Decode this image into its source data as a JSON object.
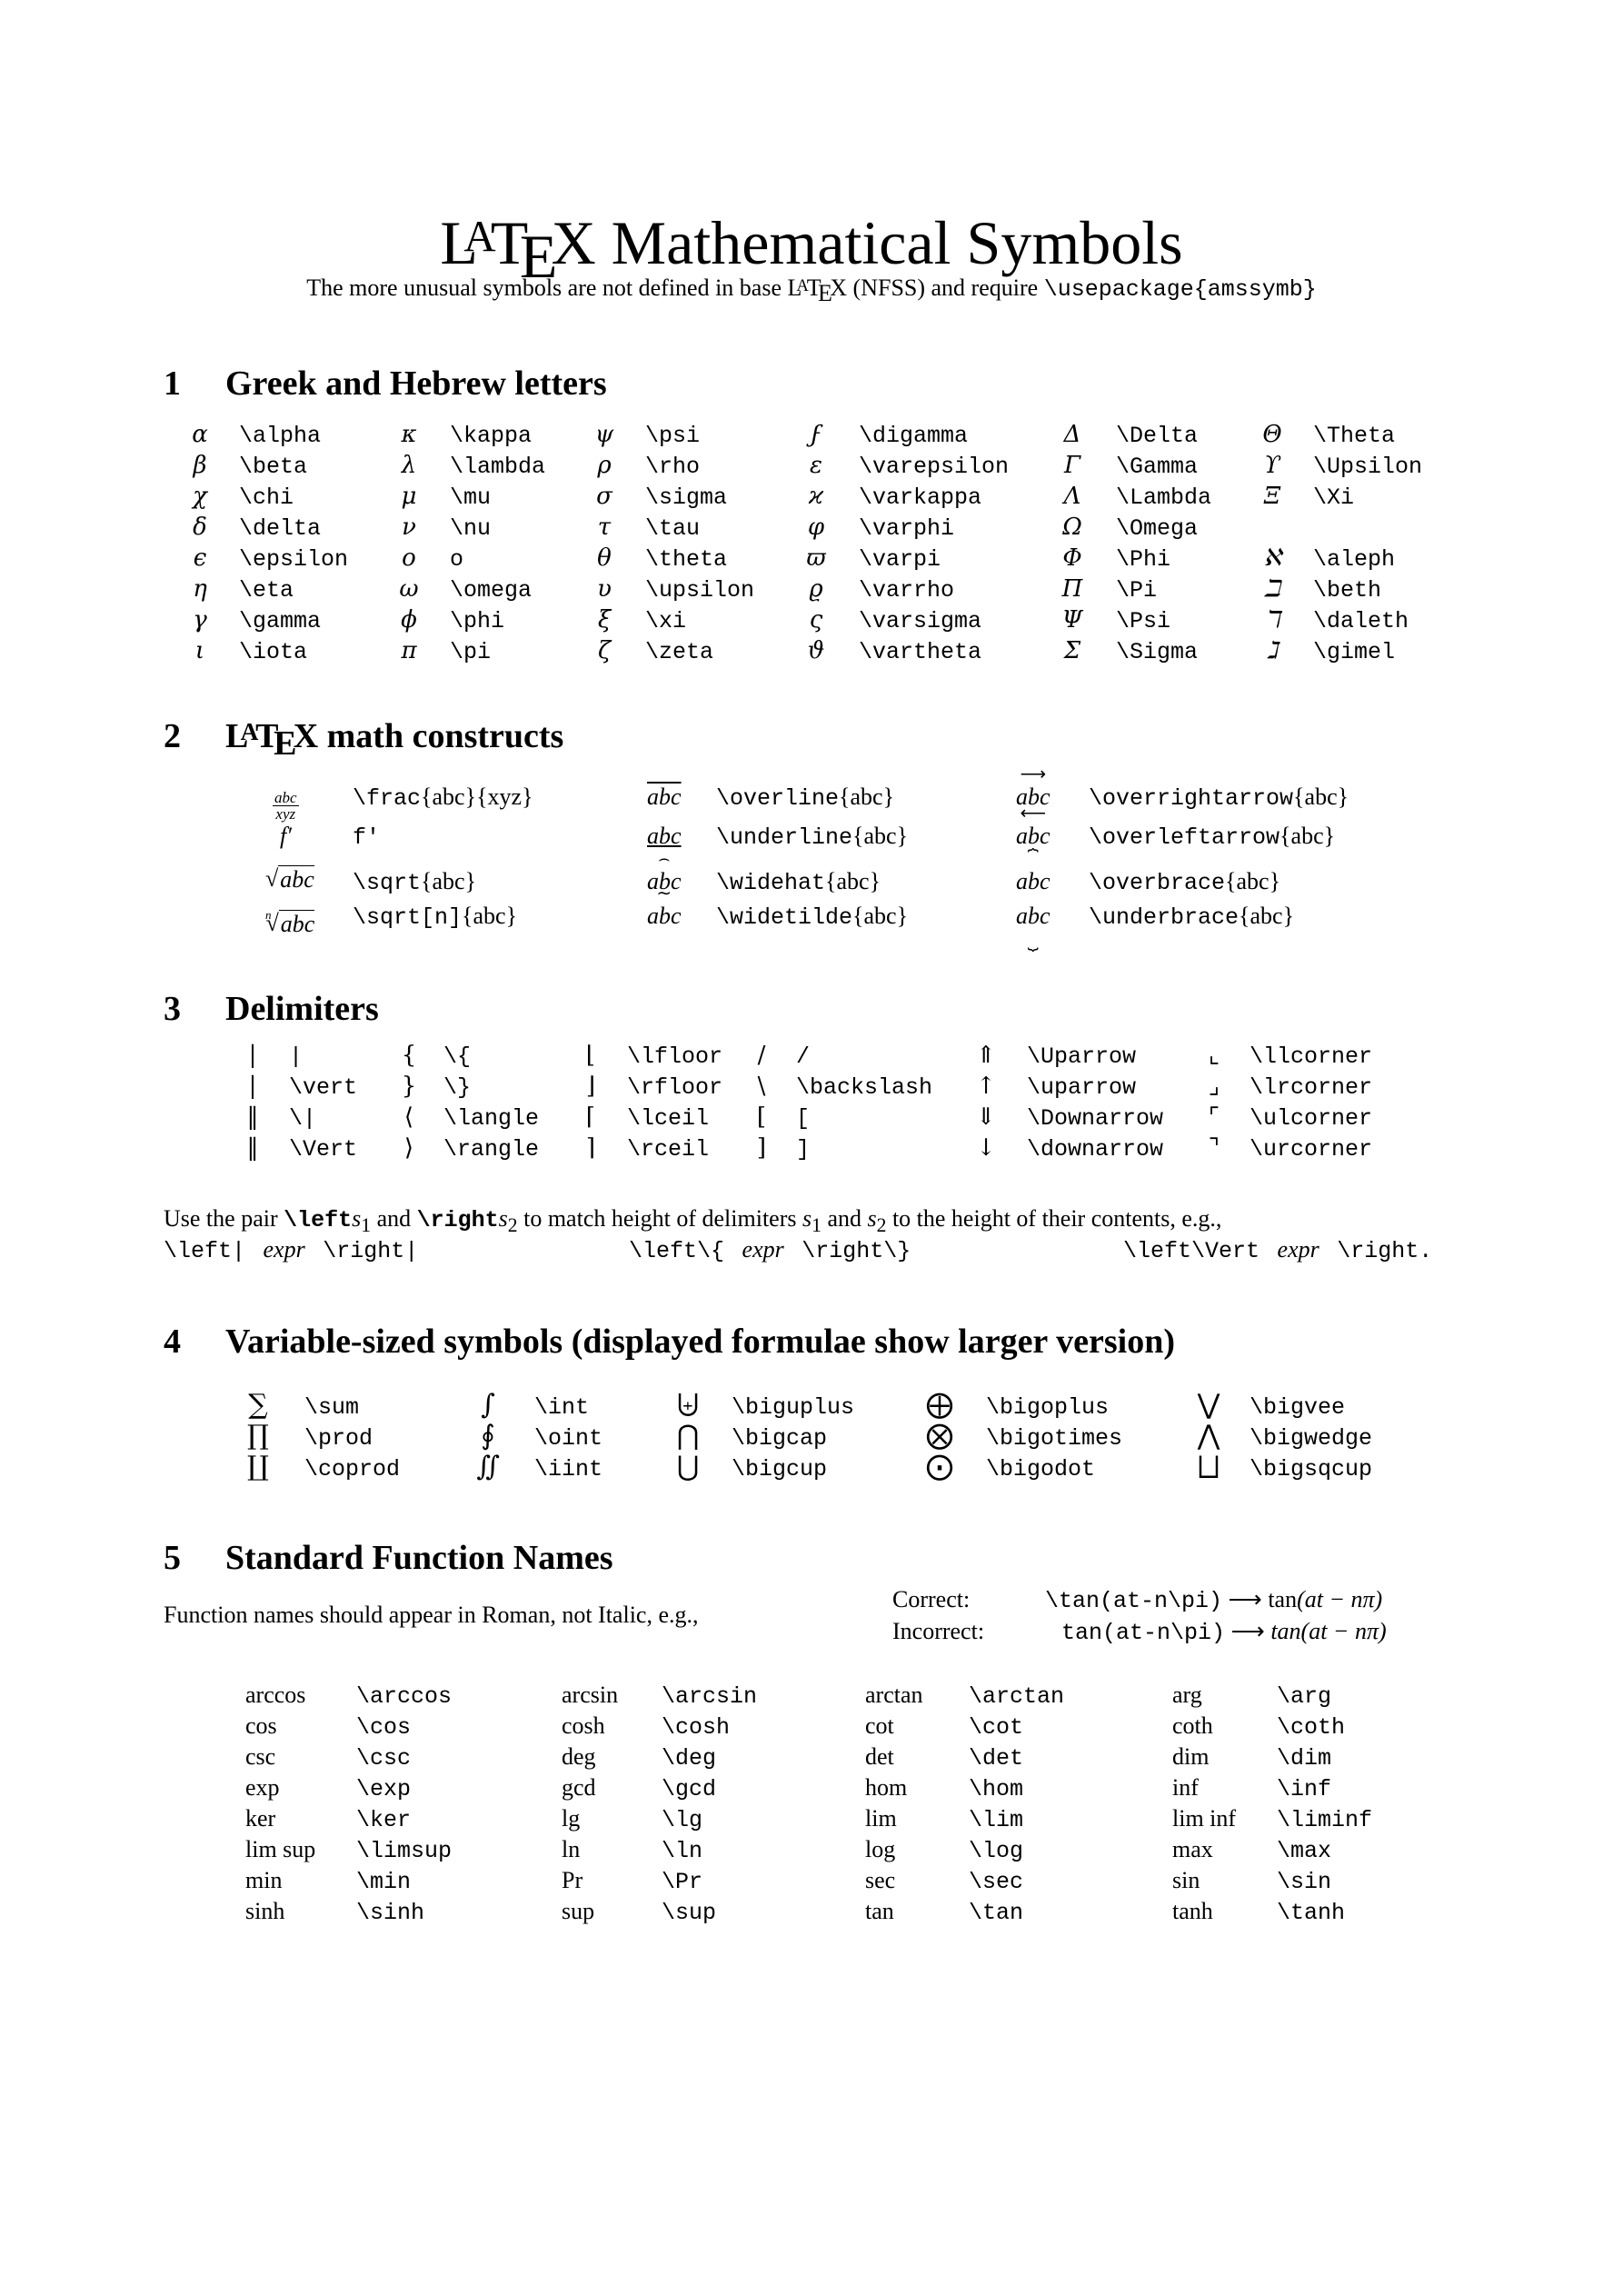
{
  "header": {
    "title_prefix_latex": {
      "L": "L",
      "A": "A",
      "T": "T",
      "E": "E",
      "X": "X"
    },
    "title_rest": "Mathematical Symbols",
    "subtitle_before": "The more unusual symbols are not defined in base",
    "subtitle_mid": "(NFSS) and require",
    "subtitle_cmd": "\\usepackage{amssymb}"
  },
  "sections": {
    "s1": {
      "num": "1",
      "title": "Greek and Hebrew letters"
    },
    "s2": {
      "num": "2",
      "title_rest": "math constructs"
    },
    "s3": {
      "num": "3",
      "title": "Delimiters"
    },
    "s4": {
      "num": "4",
      "title": "Variable-sized symbols (displayed formulae show larger version)"
    },
    "s5": {
      "num": "5",
      "title": "Standard Function Names"
    }
  },
  "greek": {
    "columns": [
      [
        {
          "sym": "α",
          "cmd": "\\alpha"
        },
        {
          "sym": "β",
          "cmd": "\\beta"
        },
        {
          "sym": "χ",
          "cmd": "\\chi"
        },
        {
          "sym": "δ",
          "cmd": "\\delta"
        },
        {
          "sym": "ϵ",
          "cmd": "\\epsilon"
        },
        {
          "sym": "η",
          "cmd": "\\eta"
        },
        {
          "sym": "γ",
          "cmd": "\\gamma"
        },
        {
          "sym": "ι",
          "cmd": "\\iota"
        }
      ],
      [
        {
          "sym": "κ",
          "cmd": "\\kappa"
        },
        {
          "sym": "λ",
          "cmd": "\\lambda"
        },
        {
          "sym": "μ",
          "cmd": "\\mu"
        },
        {
          "sym": "ν",
          "cmd": "\\nu"
        },
        {
          "sym": "o",
          "cmd": "o"
        },
        {
          "sym": "ω",
          "cmd": "\\omega"
        },
        {
          "sym": "ϕ",
          "cmd": "\\phi"
        },
        {
          "sym": "π",
          "cmd": "\\pi"
        }
      ],
      [
        {
          "sym": "ψ",
          "cmd": "\\psi"
        },
        {
          "sym": "ρ",
          "cmd": "\\rho"
        },
        {
          "sym": "σ",
          "cmd": "\\sigma"
        },
        {
          "sym": "τ",
          "cmd": "\\tau"
        },
        {
          "sym": "θ",
          "cmd": "\\theta"
        },
        {
          "sym": "υ",
          "cmd": "\\upsilon"
        },
        {
          "sym": "ξ",
          "cmd": "\\xi"
        },
        {
          "sym": "ζ",
          "cmd": "\\zeta"
        }
      ],
      [
        {
          "sym": "ϝ",
          "cmd": "\\digamma"
        },
        {
          "sym": "ε",
          "cmd": "\\varepsilon"
        },
        {
          "sym": "ϰ",
          "cmd": "\\varkappa"
        },
        {
          "sym": "φ",
          "cmd": "\\varphi"
        },
        {
          "sym": "ϖ",
          "cmd": "\\varpi"
        },
        {
          "sym": "ϱ",
          "cmd": "\\varrho"
        },
        {
          "sym": "ς",
          "cmd": "\\varsigma"
        },
        {
          "sym": "ϑ",
          "cmd": "\\vartheta"
        }
      ],
      [
        {
          "sym": "Δ",
          "cmd": "\\Delta"
        },
        {
          "sym": "Γ",
          "cmd": "\\Gamma"
        },
        {
          "sym": "Λ",
          "cmd": "\\Lambda"
        },
        {
          "sym": "Ω",
          "cmd": "\\Omega"
        },
        {
          "sym": "Φ",
          "cmd": "\\Phi"
        },
        {
          "sym": "Π",
          "cmd": "\\Pi"
        },
        {
          "sym": "Ψ",
          "cmd": "\\Psi"
        },
        {
          "sym": "Σ",
          "cmd": "\\Sigma"
        }
      ],
      [
        {
          "sym": "Θ",
          "cmd": "\\Theta"
        },
        {
          "sym": "ϒ",
          "cmd": "\\Upsilon"
        },
        {
          "sym": "Ξ",
          "cmd": "\\Xi"
        },
        {
          "sym": "",
          "cmd": ""
        },
        {
          "sym": "ℵ",
          "cmd": "\\aleph"
        },
        {
          "sym": "ℶ",
          "cmd": "\\beth"
        },
        {
          "sym": "ℸ",
          "cmd": "\\daleth"
        },
        {
          "sym": "ℷ",
          "cmd": "\\gimel"
        }
      ]
    ]
  },
  "constructs": {
    "frac": {
      "num": "abc",
      "den": "xyz",
      "cmd": "\\frac",
      "arg1": "{abc}",
      "arg2": "{xyz}"
    },
    "prime": {
      "sym": "f′",
      "cmd": "f'"
    },
    "sqrt": {
      "sym": "abc",
      "cmd": "\\sqrt",
      "arg": "{abc}"
    },
    "sqrtn": {
      "idx": "n",
      "sym": "abc",
      "cmd": "\\sqrt[n]",
      "arg": "{abc}"
    },
    "overline": {
      "sym": "abc",
      "cmd": "\\overline",
      "arg": "{abc}"
    },
    "underline": {
      "sym": "abc",
      "cmd": "\\underline",
      "arg": "{abc}"
    },
    "widehat": {
      "sym": "abc",
      "mark": "⌢",
      "cmd": "\\widehat",
      "arg": "{abc}"
    },
    "widetilde": {
      "sym": "abc",
      "mark": "∼",
      "cmd": "\\widetilde",
      "arg": "{abc}"
    },
    "overrightarrow": {
      "sym": "abc",
      "mark": "⟶",
      "cmd": "\\overrightarrow",
      "arg": "{abc}"
    },
    "overleftarrow": {
      "sym": "abc",
      "mark": "⟵",
      "cmd": "\\overleftarrow",
      "arg": "{abc}"
    },
    "overbrace": {
      "sym": "abc",
      "mark": "⏞",
      "cmd": "\\overbrace",
      "arg": "{abc}"
    },
    "underbrace": {
      "sym": "abc",
      "mark": "⏟",
      "cmd": "\\underbrace",
      "arg": "{abc}"
    }
  },
  "delimiters": {
    "columns": [
      [
        {
          "sym": "|",
          "cmd": "|"
        },
        {
          "sym": "|",
          "cmd": "\\vert"
        },
        {
          "sym": "‖",
          "cmd": "\\|"
        },
        {
          "sym": "‖",
          "cmd": "\\Vert"
        }
      ],
      [
        {
          "sym": "{",
          "cmd": "\\{"
        },
        {
          "sym": "}",
          "cmd": "\\}"
        },
        {
          "sym": "⟨",
          "cmd": "\\langle"
        },
        {
          "sym": "⟩",
          "cmd": "\\rangle"
        }
      ],
      [
        {
          "sym": "⌊",
          "cmd": "\\lfloor"
        },
        {
          "sym": "⌋",
          "cmd": "\\rfloor"
        },
        {
          "sym": "⌈",
          "cmd": "\\lceil"
        },
        {
          "sym": "⌉",
          "cmd": "\\rceil"
        }
      ],
      [
        {
          "sym": "/",
          "cmd": "/"
        },
        {
          "sym": "\\",
          "cmd": "\\backslash"
        },
        {
          "sym": "[",
          "cmd": "["
        },
        {
          "sym": "]",
          "cmd": "]"
        }
      ],
      [
        {
          "sym": "⇑",
          "cmd": "\\Uparrow"
        },
        {
          "sym": "↑",
          "cmd": "\\uparrow"
        },
        {
          "sym": "⇓",
          "cmd": "\\Downarrow"
        },
        {
          "sym": "↓",
          "cmd": "\\downarrow"
        }
      ],
      [
        {
          "sym": "⌞",
          "cmd": "\\llcorner"
        },
        {
          "sym": "⌟",
          "cmd": "\\lrcorner"
        },
        {
          "sym": "⌜",
          "cmd": "\\ulcorner"
        },
        {
          "sym": "⌝",
          "cmd": "\\urcorner"
        }
      ]
    ],
    "note": {
      "t1": "Use the pair",
      "c1": "\\left",
      "s1": "s",
      "sub1": "1",
      "t2": "and",
      "c2": "\\right",
      "s2": "s",
      "sub2": "2",
      "t3": "to match height of delimiters",
      "t4": "and",
      "t5": "to the height of their contents, e.g.,"
    },
    "examples": [
      {
        "left": "\\left|",
        "expr": "expr",
        "right": "\\right|"
      },
      {
        "left": "\\left\\{",
        "expr": "expr",
        "right": "\\right\\}"
      },
      {
        "left": "\\left\\Vert",
        "expr": "expr",
        "right": "\\right."
      }
    ]
  },
  "variable_sized": {
    "columns": [
      [
        {
          "sym": "∑",
          "cmd": "\\sum"
        },
        {
          "sym": "∏",
          "cmd": "\\prod"
        },
        {
          "sym": "∐",
          "cmd": "\\coprod"
        }
      ],
      [
        {
          "sym": "∫",
          "cmd": "\\int"
        },
        {
          "sym": "∮",
          "cmd": "\\oint"
        },
        {
          "sym": "∬",
          "cmd": "\\iint"
        }
      ],
      [
        {
          "sym": "⨄",
          "cmd": "\\biguplus"
        },
        {
          "sym": "⋂",
          "cmd": "\\bigcap"
        },
        {
          "sym": "⋃",
          "cmd": "\\bigcup"
        }
      ],
      [
        {
          "sym": "⨁",
          "cmd": "\\bigoplus"
        },
        {
          "sym": "⨂",
          "cmd": "\\bigotimes"
        },
        {
          "sym": "⨀",
          "cmd": "\\bigodot"
        }
      ],
      [
        {
          "sym": "⋁",
          "cmd": "\\bigvee"
        },
        {
          "sym": "⋀",
          "cmd": "\\bigwedge"
        },
        {
          "sym": "⨆",
          "cmd": "\\bigsqcup"
        }
      ]
    ]
  },
  "functions": {
    "intro": "Function names should appear in Roman, not Italic, e.g.,",
    "correct": {
      "label": "Correct:",
      "code": "\\tan(at-n\\pi)",
      "arrow": "⟶",
      "result_fn": "tan",
      "result_arg": "(at − nπ)"
    },
    "incorrect": {
      "label": "Incorrect:",
      "code": "tan(at-n\\pi)",
      "arrow": "⟶",
      "result_fn": "tan",
      "result_arg": "(at − nπ)"
    },
    "columns": [
      [
        {
          "name": "arccos",
          "cmd": "\\arccos"
        },
        {
          "name": "cos",
          "cmd": "\\cos"
        },
        {
          "name": "csc",
          "cmd": "\\csc"
        },
        {
          "name": "exp",
          "cmd": "\\exp"
        },
        {
          "name": "ker",
          "cmd": "\\ker"
        },
        {
          "name": "lim sup",
          "cmd": "\\limsup"
        },
        {
          "name": "min",
          "cmd": "\\min"
        },
        {
          "name": "sinh",
          "cmd": "\\sinh"
        }
      ],
      [
        {
          "name": "arcsin",
          "cmd": "\\arcsin"
        },
        {
          "name": "cosh",
          "cmd": "\\cosh"
        },
        {
          "name": "deg",
          "cmd": "\\deg"
        },
        {
          "name": "gcd",
          "cmd": "\\gcd"
        },
        {
          "name": "lg",
          "cmd": "\\lg"
        },
        {
          "name": "ln",
          "cmd": "\\ln"
        },
        {
          "name": "Pr",
          "cmd": "\\Pr"
        },
        {
          "name": "sup",
          "cmd": "\\sup"
        }
      ],
      [
        {
          "name": "arctan",
          "cmd": "\\arctan"
        },
        {
          "name": "cot",
          "cmd": "\\cot"
        },
        {
          "name": "det",
          "cmd": "\\det"
        },
        {
          "name": "hom",
          "cmd": "\\hom"
        },
        {
          "name": "lim",
          "cmd": "\\lim"
        },
        {
          "name": "log",
          "cmd": "\\log"
        },
        {
          "name": "sec",
          "cmd": "\\sec"
        },
        {
          "name": "tan",
          "cmd": "\\tan"
        }
      ],
      [
        {
          "name": "arg",
          "cmd": "\\arg"
        },
        {
          "name": "coth",
          "cmd": "\\coth"
        },
        {
          "name": "dim",
          "cmd": "\\dim"
        },
        {
          "name": "inf",
          "cmd": "\\inf"
        },
        {
          "name": "lim inf",
          "cmd": "\\liminf"
        },
        {
          "name": "max",
          "cmd": "\\max"
        },
        {
          "name": "sin",
          "cmd": "\\sin"
        },
        {
          "name": "tanh",
          "cmd": "\\tanh"
        }
      ]
    ]
  }
}
